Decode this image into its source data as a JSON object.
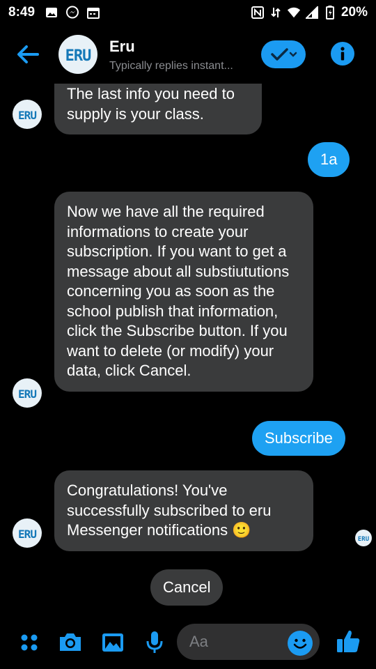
{
  "status_bar": {
    "time": "8:49",
    "battery": "20%"
  },
  "header": {
    "back_icon": "arrow-left-icon",
    "title": "Eru",
    "subtitle": "Typically replies instant...",
    "avatar_text": "ERU",
    "check_icon": "check-chevron-icon",
    "info_icon": "info-icon"
  },
  "messages": [
    {
      "direction": "in",
      "text": "The last info you need to supply is your class."
    },
    {
      "direction": "out",
      "text": "1a"
    },
    {
      "direction": "in",
      "text": "Now we have all the required informations to create your subscription. If you want to get a message about all substiututions concerning you as soon as the school publish that information, click the Subscribe button. If you want to delete (or modify) your data, click Cancel."
    },
    {
      "direction": "out",
      "text": "Subscribe"
    },
    {
      "direction": "in",
      "text": "Congratulations! You've successfully subscribed to eru Messenger notifications 🙂"
    }
  ],
  "quick_reply": {
    "label": "Cancel"
  },
  "composer": {
    "placeholder": "Aa",
    "icons": [
      "menu-dots-icon",
      "camera-icon",
      "image-icon",
      "microphone-icon",
      "emoji-icon",
      "thumbs-up-icon"
    ]
  },
  "colors": {
    "accent": "#1b9bf2",
    "bubble_in": "#3a3b3c",
    "background": "#000000"
  }
}
